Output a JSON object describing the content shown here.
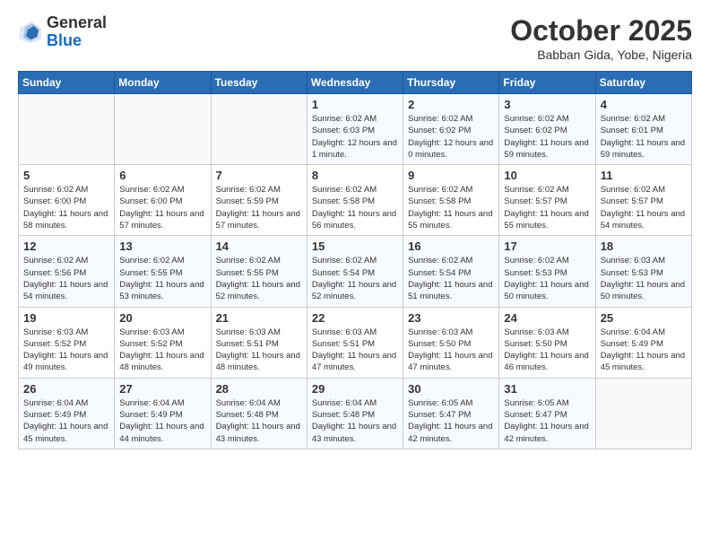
{
  "header": {
    "logo_general": "General",
    "logo_blue": "Blue",
    "month_title": "October 2025",
    "location": "Babban Gida, Yobe, Nigeria"
  },
  "days_of_week": [
    "Sunday",
    "Monday",
    "Tuesday",
    "Wednesday",
    "Thursday",
    "Friday",
    "Saturday"
  ],
  "weeks": [
    [
      {
        "day": "",
        "sunrise": "",
        "sunset": "",
        "daylight": ""
      },
      {
        "day": "",
        "sunrise": "",
        "sunset": "",
        "daylight": ""
      },
      {
        "day": "",
        "sunrise": "",
        "sunset": "",
        "daylight": ""
      },
      {
        "day": "1",
        "sunrise": "Sunrise: 6:02 AM",
        "sunset": "Sunset: 6:03 PM",
        "daylight": "Daylight: 12 hours and 1 minute."
      },
      {
        "day": "2",
        "sunrise": "Sunrise: 6:02 AM",
        "sunset": "Sunset: 6:02 PM",
        "daylight": "Daylight: 12 hours and 0 minutes."
      },
      {
        "day": "3",
        "sunrise": "Sunrise: 6:02 AM",
        "sunset": "Sunset: 6:02 PM",
        "daylight": "Daylight: 11 hours and 59 minutes."
      },
      {
        "day": "4",
        "sunrise": "Sunrise: 6:02 AM",
        "sunset": "Sunset: 6:01 PM",
        "daylight": "Daylight: 11 hours and 59 minutes."
      }
    ],
    [
      {
        "day": "5",
        "sunrise": "Sunrise: 6:02 AM",
        "sunset": "Sunset: 6:00 PM",
        "daylight": "Daylight: 11 hours and 58 minutes."
      },
      {
        "day": "6",
        "sunrise": "Sunrise: 6:02 AM",
        "sunset": "Sunset: 6:00 PM",
        "daylight": "Daylight: 11 hours and 57 minutes."
      },
      {
        "day": "7",
        "sunrise": "Sunrise: 6:02 AM",
        "sunset": "Sunset: 5:59 PM",
        "daylight": "Daylight: 11 hours and 57 minutes."
      },
      {
        "day": "8",
        "sunrise": "Sunrise: 6:02 AM",
        "sunset": "Sunset: 5:58 PM",
        "daylight": "Daylight: 11 hours and 56 minutes."
      },
      {
        "day": "9",
        "sunrise": "Sunrise: 6:02 AM",
        "sunset": "Sunset: 5:58 PM",
        "daylight": "Daylight: 11 hours and 55 minutes."
      },
      {
        "day": "10",
        "sunrise": "Sunrise: 6:02 AM",
        "sunset": "Sunset: 5:57 PM",
        "daylight": "Daylight: 11 hours and 55 minutes."
      },
      {
        "day": "11",
        "sunrise": "Sunrise: 6:02 AM",
        "sunset": "Sunset: 5:57 PM",
        "daylight": "Daylight: 11 hours and 54 minutes."
      }
    ],
    [
      {
        "day": "12",
        "sunrise": "Sunrise: 6:02 AM",
        "sunset": "Sunset: 5:56 PM",
        "daylight": "Daylight: 11 hours and 54 minutes."
      },
      {
        "day": "13",
        "sunrise": "Sunrise: 6:02 AM",
        "sunset": "Sunset: 5:55 PM",
        "daylight": "Daylight: 11 hours and 53 minutes."
      },
      {
        "day": "14",
        "sunrise": "Sunrise: 6:02 AM",
        "sunset": "Sunset: 5:55 PM",
        "daylight": "Daylight: 11 hours and 52 minutes."
      },
      {
        "day": "15",
        "sunrise": "Sunrise: 6:02 AM",
        "sunset": "Sunset: 5:54 PM",
        "daylight": "Daylight: 11 hours and 52 minutes."
      },
      {
        "day": "16",
        "sunrise": "Sunrise: 6:02 AM",
        "sunset": "Sunset: 5:54 PM",
        "daylight": "Daylight: 11 hours and 51 minutes."
      },
      {
        "day": "17",
        "sunrise": "Sunrise: 6:02 AM",
        "sunset": "Sunset: 5:53 PM",
        "daylight": "Daylight: 11 hours and 50 minutes."
      },
      {
        "day": "18",
        "sunrise": "Sunrise: 6:03 AM",
        "sunset": "Sunset: 5:53 PM",
        "daylight": "Daylight: 11 hours and 50 minutes."
      }
    ],
    [
      {
        "day": "19",
        "sunrise": "Sunrise: 6:03 AM",
        "sunset": "Sunset: 5:52 PM",
        "daylight": "Daylight: 11 hours and 49 minutes."
      },
      {
        "day": "20",
        "sunrise": "Sunrise: 6:03 AM",
        "sunset": "Sunset: 5:52 PM",
        "daylight": "Daylight: 11 hours and 48 minutes."
      },
      {
        "day": "21",
        "sunrise": "Sunrise: 6:03 AM",
        "sunset": "Sunset: 5:51 PM",
        "daylight": "Daylight: 11 hours and 48 minutes."
      },
      {
        "day": "22",
        "sunrise": "Sunrise: 6:03 AM",
        "sunset": "Sunset: 5:51 PM",
        "daylight": "Daylight: 11 hours and 47 minutes."
      },
      {
        "day": "23",
        "sunrise": "Sunrise: 6:03 AM",
        "sunset": "Sunset: 5:50 PM",
        "daylight": "Daylight: 11 hours and 47 minutes."
      },
      {
        "day": "24",
        "sunrise": "Sunrise: 6:03 AM",
        "sunset": "Sunset: 5:50 PM",
        "daylight": "Daylight: 11 hours and 46 minutes."
      },
      {
        "day": "25",
        "sunrise": "Sunrise: 6:04 AM",
        "sunset": "Sunset: 5:49 PM",
        "daylight": "Daylight: 11 hours and 45 minutes."
      }
    ],
    [
      {
        "day": "26",
        "sunrise": "Sunrise: 6:04 AM",
        "sunset": "Sunset: 5:49 PM",
        "daylight": "Daylight: 11 hours and 45 minutes."
      },
      {
        "day": "27",
        "sunrise": "Sunrise: 6:04 AM",
        "sunset": "Sunset: 5:49 PM",
        "daylight": "Daylight: 11 hours and 44 minutes."
      },
      {
        "day": "28",
        "sunrise": "Sunrise: 6:04 AM",
        "sunset": "Sunset: 5:48 PM",
        "daylight": "Daylight: 11 hours and 43 minutes."
      },
      {
        "day": "29",
        "sunrise": "Sunrise: 6:04 AM",
        "sunset": "Sunset: 5:48 PM",
        "daylight": "Daylight: 11 hours and 43 minutes."
      },
      {
        "day": "30",
        "sunrise": "Sunrise: 6:05 AM",
        "sunset": "Sunset: 5:47 PM",
        "daylight": "Daylight: 11 hours and 42 minutes."
      },
      {
        "day": "31",
        "sunrise": "Sunrise: 6:05 AM",
        "sunset": "Sunset: 5:47 PM",
        "daylight": "Daylight: 11 hours and 42 minutes."
      },
      {
        "day": "",
        "sunrise": "",
        "sunset": "",
        "daylight": ""
      }
    ]
  ]
}
